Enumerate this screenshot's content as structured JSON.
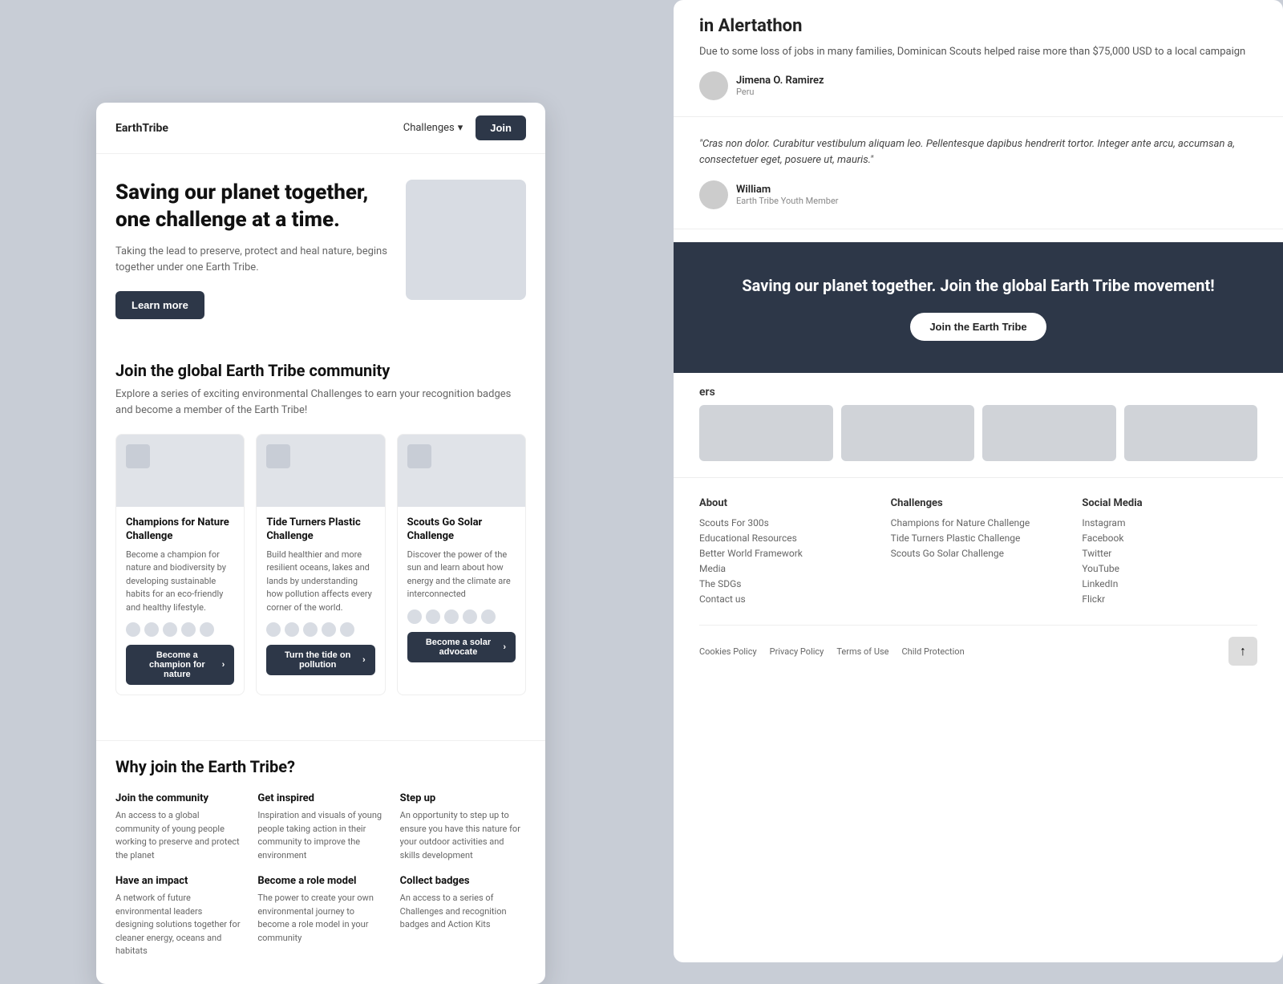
{
  "nav": {
    "logo": "EarthTribe",
    "challenges_label": "Challenges",
    "join_label": "Join"
  },
  "hero": {
    "headline": "Saving our planet together, one challenge at a time.",
    "description": "Taking the lead to preserve, protect and heal nature, begins together under one Earth Tribe.",
    "cta_label": "Learn more",
    "image_alt": "hero-image"
  },
  "community": {
    "title": "Join the global Earth Tribe community",
    "description": "Explore a series of exciting environmental Challenges to earn your recognition badges and become a member of the Earth Tribe!"
  },
  "challenges": [
    {
      "title": "Champions for Nature Challenge",
      "description": "Become a champion for nature and biodiversity by developing sustainable habits for an eco-friendly and healthy lifestyle.",
      "cta": "Become a champion for nature"
    },
    {
      "title": "Tide Turners Plastic Challenge",
      "description": "Build healthier and more resilient oceans, lakes and lands by understanding how pollution affects every corner of the world.",
      "cta": "Turn the tide on pollution"
    },
    {
      "title": "Scouts Go Solar Challenge",
      "description": "Discover the power of the sun and learn about how energy and the climate are interconnected",
      "cta": "Become a solar advocate"
    }
  ],
  "why": {
    "title": "Why join the Earth Tribe?",
    "items": [
      {
        "heading": "Join the community",
        "text": "An access to a global community of young people working to preserve and protect the planet"
      },
      {
        "heading": "Get inspired",
        "text": "Inspiration and visuals of young people taking action in their community to improve the environment"
      },
      {
        "heading": "Step up",
        "text": "An opportunity to step up to ensure you have this nature for your outdoor activities and skills development"
      },
      {
        "heading": "Have an impact",
        "text": "A network of future environmental leaders designing solutions together for cleaner energy, oceans and habitats"
      },
      {
        "heading": "Become a role model",
        "text": "The power to create your own environmental journey to become a role model in your community"
      },
      {
        "heading": "Collect badges",
        "text": "An access to a series of Challenges and recognition badges and Action Kits"
      }
    ]
  },
  "right_panel": {
    "alertathon_title": "in Alertathon",
    "alertathon_text": "Due to some loss of jobs in many families, Dominican Scouts helped raise more than $75,000 USD to a local campaign",
    "alertathon_reviewer_name": "Jimena O. Ramirez",
    "alertathon_reviewer_sub": "Peru",
    "quote_text": "\"Cras non dolor. Curabitur vestibulum aliquam leo. Pellentesque dapibus hendrerit tortor. Integer ante arcu, accumsan a, consectetuer eget, posuere ut, mauris.\"",
    "quote_reviewer_name": "William",
    "quote_reviewer_sub": "Earth Tribe Youth Member",
    "cta_title": "Saving our planet together. Join the global Earth Tribe movement!",
    "cta_btn": "Join the Earth Tribe",
    "testimonials_label": "ers",
    "footer": {
      "about": {
        "title": "About",
        "links": [
          "Scouts For 300s",
          "Educational Resources",
          "Better World Framework",
          "Media",
          "The SDGs",
          "Contact us"
        ]
      },
      "challenges": {
        "title": "Challenges",
        "links": [
          "Champions for Nature Challenge",
          "Tide Turners Plastic Challenge",
          "Scouts Go Solar Challenge"
        ]
      },
      "social": {
        "title": "Social Media",
        "links": [
          "Instagram",
          "Facebook",
          "Twitter",
          "YouTube",
          "LinkedIn",
          "Flickr"
        ]
      }
    },
    "footer_links": [
      "Cookies Policy",
      "Privacy Policy",
      "Terms of Use",
      "Child Protection"
    ]
  }
}
